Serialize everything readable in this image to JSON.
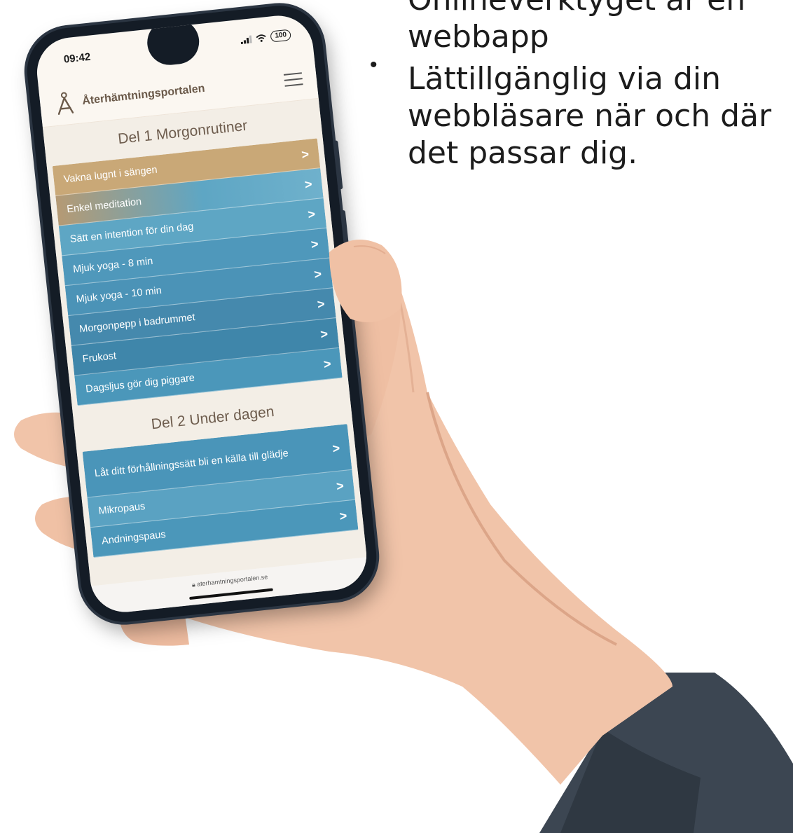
{
  "slide": {
    "cut_off_line": "Onlineverktyget är en",
    "continued_line": "webbapp",
    "bullet_glyph": "•",
    "bullet_lines": [
      "Lättillgänglig via din",
      "webbläsare när och där",
      "det passar dig."
    ]
  },
  "phone": {
    "status_time": "09:42",
    "battery_level": "100",
    "app_name": "Återhämtningsportalen",
    "sections": [
      {
        "title": "Del 1 Morgonrutiner",
        "items": [
          "Vakna lugnt i sängen",
          "Enkel meditation",
          "Sätt en intention för din dag",
          "Mjuk yoga - 8 min",
          "Mjuk yoga - 10 min",
          "Morgonpepp i badrummet",
          "Frukost",
          "Dagsljus gör dig piggare"
        ]
      },
      {
        "title": "Del 2 Under dagen",
        "items": [
          "Låt ditt förhållningssätt bli en källa till glädje",
          "Mikropaus",
          "Andningspaus"
        ]
      }
    ],
    "url": "aterhamtningsportalen.se",
    "chevron_glyph": ">"
  },
  "colors": {
    "list_sand": "#c9a877",
    "list_blue_light": "#5ea6c4",
    "list_blue_dark": "#3f86aa",
    "header_text": "#6b5a4a",
    "skin": "#f1c4a9",
    "sleeve": "#3c4652"
  }
}
